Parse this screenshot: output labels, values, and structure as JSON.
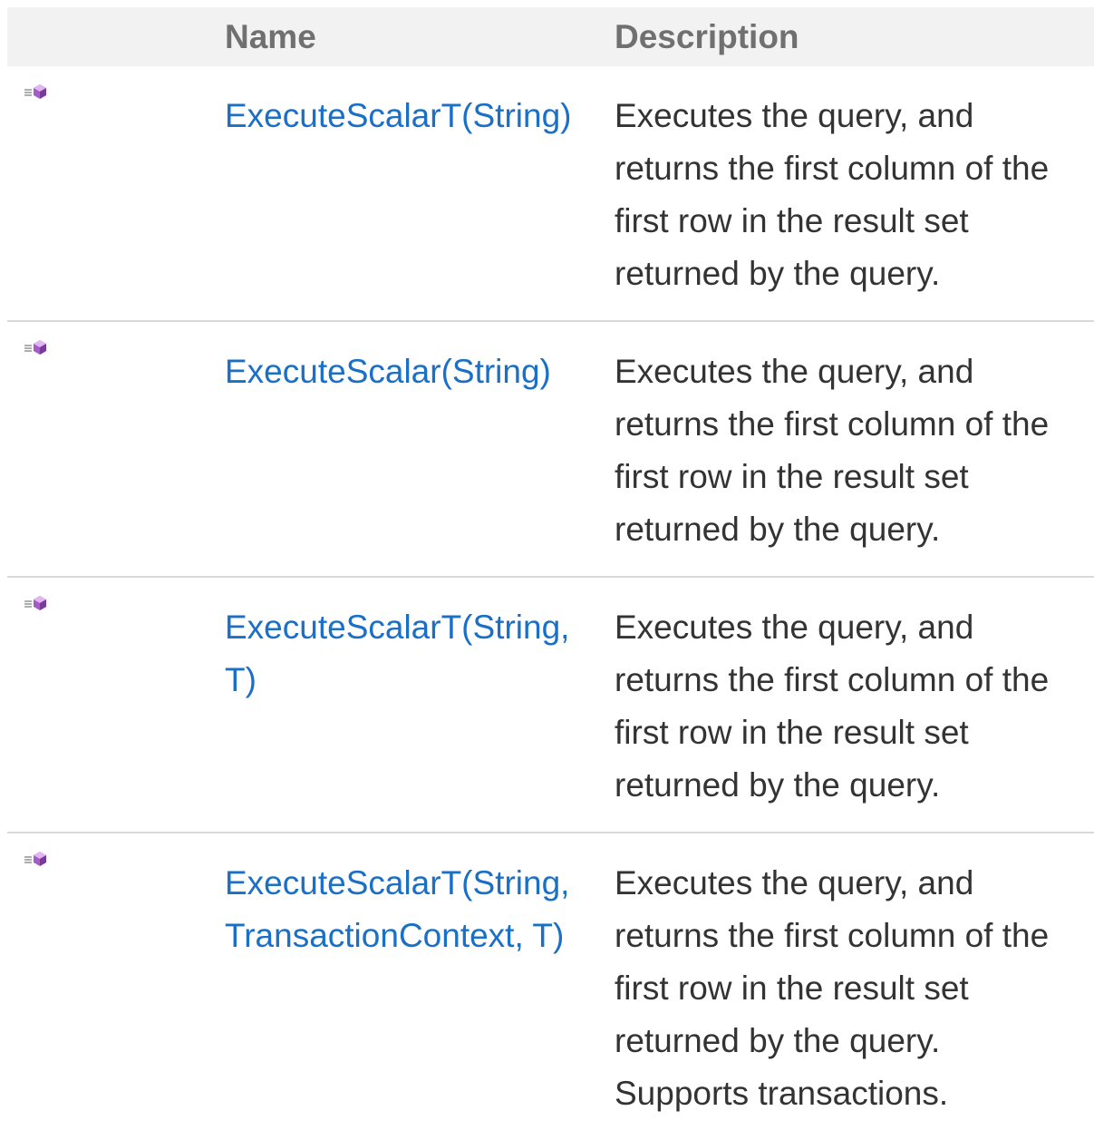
{
  "table": {
    "headers": {
      "name": "Name",
      "description": "Description"
    },
    "rows": [
      {
        "icon": "public-method-icon",
        "name": "ExecuteScalarT(String)",
        "description": "Executes the query, and returns the first column of the first row in the result set returned by the query."
      },
      {
        "icon": "public-method-icon",
        "name": "ExecuteScalar(String)",
        "description": "Executes the query, and returns the first column of the first row in the result set returned by the query."
      },
      {
        "icon": "public-method-icon",
        "name": "ExecuteScalarT(String, T)",
        "description": "Executes the query, and returns the first column of the first row in the result set returned by the query."
      },
      {
        "icon": "public-method-icon",
        "name": "ExecuteScalarT(String, TransactionContext, T)",
        "description": "Executes the query, and returns the first column of the first row in the result set returned by the query. Supports transactions."
      }
    ]
  },
  "colors": {
    "link": "#1a6fc6",
    "header_bg": "#f2f2f2",
    "header_text": "#707070",
    "body_text": "#333333",
    "divider": "#d9d9d9"
  }
}
